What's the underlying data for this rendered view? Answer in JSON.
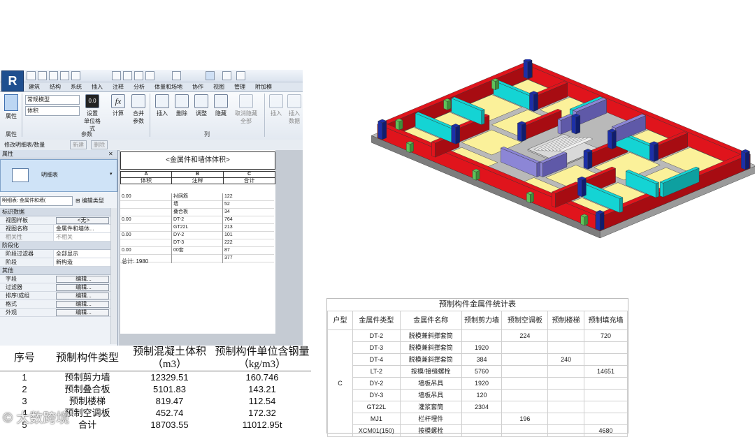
{
  "revit": {
    "logo": "R",
    "tabs": [
      "建筑",
      "结构",
      "系统",
      "插入",
      "注释",
      "分析",
      "体量和场地",
      "协作",
      "视图",
      "管理",
      "附加模"
    ],
    "ribbon": {
      "type_selector": "常规模型",
      "field_selector": "体积",
      "tool_set": "设置",
      "tool_set_sub": "单位格式",
      "tool_calc": "计算",
      "tool_combine": "合并",
      "tool_combine_sub": "参数",
      "tool_insert": "插入",
      "tool_delete": "删除",
      "tool_adjust": "调整",
      "tool_hide": "隐藏",
      "tool_unhide": "取消隐藏",
      "tool_unhide_sub": "全部",
      "tool_insert2": "插入",
      "tool_data": "插入",
      "tool_data_sub": "数据",
      "group_props": "属性",
      "group_params": "参数",
      "group_columns": "列",
      "props_button": "属性"
    },
    "modify_bar": {
      "label": "修改明细表/数量",
      "btn_new": "新建",
      "btn_delete": "删除"
    },
    "properties": {
      "header": "属性",
      "type_name": "明细表",
      "instance_selector": "明细表: 金属件和墙(",
      "edit_type": "编辑类型",
      "groups": [
        {
          "name": "标识数据",
          "rows": [
            {
              "k": "视图样板",
              "v": "<无>",
              "btn": true
            },
            {
              "k": "视图名称",
              "v": "金属件和墙体..."
            },
            {
              "k": "相关性",
              "v": "不相关"
            }
          ]
        },
        {
          "name": "阶段化",
          "rows": [
            {
              "k": "阶段过滤器",
              "v": "全部显示"
            },
            {
              "k": "阶段",
              "v": "新构造"
            }
          ]
        },
        {
          "name": "其他",
          "rows": [
            {
              "k": "字段",
              "v": "编辑...",
              "btn": true
            },
            {
              "k": "过滤器",
              "v": "编辑...",
              "btn": true
            },
            {
              "k": "排序/成组",
              "v": "编辑...",
              "btn": true
            },
            {
              "k": "格式",
              "v": "编辑...",
              "btn": true
            },
            {
              "k": "外观",
              "v": "编辑...",
              "btn": true
            }
          ]
        }
      ]
    },
    "schedule": {
      "title": "<金属件和墙体体积>",
      "col_letters": [
        "A",
        "B",
        "C"
      ],
      "col_names": [
        "体积",
        "注释",
        "合计"
      ],
      "rows": [
        [
          "0.00",
          "衬网筋",
          "122"
        ],
        [
          "",
          "墙",
          "52"
        ],
        [
          "",
          "叠合板",
          "34"
        ],
        [
          "0.00",
          "DT-2",
          "764"
        ],
        [
          "",
          "GT22L",
          "213"
        ],
        [
          "0.00",
          "DY-2",
          "101"
        ],
        [
          "",
          "DT-3",
          "222"
        ],
        [
          "0.00",
          "00套",
          "87"
        ],
        [
          "",
          "",
          "377"
        ]
      ],
      "total": "总计: 1980"
    }
  },
  "table1": {
    "headers": [
      "序号",
      "预制构件类型",
      "预制混凝土体积（m3）",
      "预制构件单位含钢量（kg/m3）"
    ],
    "rows": [
      [
        "1",
        "预制剪力墙",
        "12329.51",
        "160.746"
      ],
      [
        "2",
        "预制叠合板",
        "5101.83",
        "143.21"
      ],
      [
        "3",
        "预制楼梯",
        "819.47",
        "112.54"
      ],
      [
        "4",
        "预制空调板",
        "452.74",
        "172.32"
      ],
      [
        "5",
        "合计",
        "18703.55",
        "11012.95t"
      ]
    ]
  },
  "watermark": "大数跨境",
  "table2": {
    "caption": "预制构件金属件统计表",
    "headers": [
      "户型",
      "金属件类型",
      "金属件名称",
      "预制剪力墙",
      "预制空调板",
      "预制楼梯",
      "预制填充墙"
    ],
    "group_label": "C",
    "rows": [
      [
        "DT-2",
        "脱模兼斜撑套筒",
        "",
        "224",
        "",
        "720"
      ],
      [
        "DT-3",
        "脱模兼斜撑套筒",
        "1920",
        "",
        "",
        ""
      ],
      [
        "DT-4",
        "脱模兼斜撑套筒",
        "384",
        "",
        "240",
        ""
      ],
      [
        "LT-2",
        "按模/接缝螺栓",
        "5760",
        "",
        "",
        "14651"
      ],
      [
        "DY-2",
        "墙板吊具",
        "1920",
        "",
        "",
        ""
      ],
      [
        "DY-3",
        "墙板吊具",
        "120",
        "",
        "",
        ""
      ],
      [
        "GT22L",
        "灌浆套筒",
        "2304",
        "",
        "",
        ""
      ],
      [
        "MJ1",
        "栏杆埋件",
        "",
        "196",
        "",
        ""
      ],
      [
        "XCM01(150)",
        "按模螺栓",
        "",
        "",
        "",
        "4680"
      ]
    ]
  },
  "colors": {
    "wall_red": "#e0141c",
    "wall_cyan": "#14d4d4",
    "wall_purple": "#8c86d6",
    "floor_yellow": "#fbf19a",
    "column_blue": "#1c2fa8",
    "connector_green": "#5ec35a",
    "concrete_grey": "#8a8a8a"
  }
}
